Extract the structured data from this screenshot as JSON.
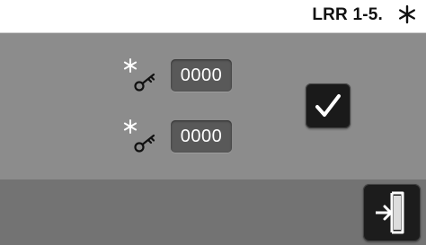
{
  "header": {
    "title": "LRR 1-5.",
    "icon": "asterisk-icon"
  },
  "code_fields": [
    {
      "icon": "key-asterisk-icon",
      "value": "0000"
    },
    {
      "icon": "key-asterisk-icon",
      "value": "0000"
    }
  ],
  "buttons": {
    "confirm_icon": "checkmark-icon",
    "exit_icon": "exit-door-icon"
  },
  "colors": {
    "header_bg": "#ffffff",
    "main_bg": "#8c8c8c",
    "footer_bg": "#737373",
    "field_bg": "#595959",
    "button_bg": "#1a1a1a"
  }
}
